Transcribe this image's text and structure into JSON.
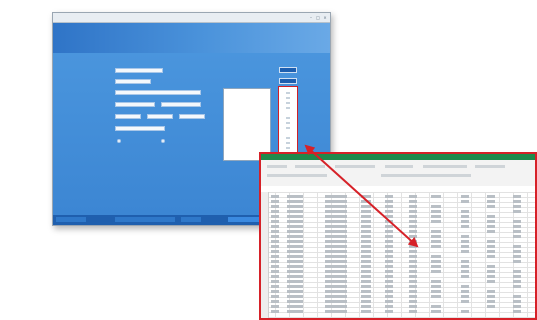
{
  "app": {
    "title": "",
    "header_text": "",
    "fields": [
      {
        "label": "",
        "value": ""
      },
      {
        "label": "",
        "value": ""
      },
      {
        "label": "",
        "value": ""
      },
      {
        "label": "",
        "value": ""
      },
      {
        "label": "",
        "value": ""
      },
      {
        "label": "",
        "value": ""
      },
      {
        "label": "",
        "value": ""
      }
    ],
    "list_title": "",
    "list_items": [
      "",
      "",
      "",
      "",
      "",
      "",
      "",
      "",
      "",
      "",
      "",
      ""
    ],
    "colors": {
      "header": "#3c86d3",
      "status_bar": "#1f5fae",
      "highlight": "#d01f26"
    }
  },
  "spreadsheet": {
    "ribbon_color": "#1f8a4c",
    "border_color": "#d62128"
  },
  "arrow": {
    "color": "#d62128",
    "icon": "double-headed-arrow-icon"
  }
}
